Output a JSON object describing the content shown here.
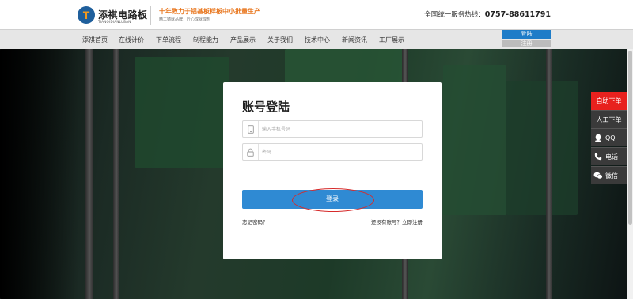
{
  "brand": {
    "name": "添祺电路板",
    "pinyin": "TIANQIDIANLUBAN",
    "slogan": "十年致力于铝基板样板中小批量生产",
    "slogan_sub": "精工铸就品牌，匠心成就理想"
  },
  "hotline": {
    "label": "全国统一服务热线：",
    "number": "0757-88611791"
  },
  "nav": {
    "items": [
      "添祺首页",
      "在线计价",
      "下单流程",
      "制程能力",
      "产品展示",
      "关于我们",
      "技术中心",
      "新闻资讯",
      "工厂展示"
    ],
    "login": "登陆",
    "register": "注册"
  },
  "login_form": {
    "title": "账号登陆",
    "phone_placeholder": "输入手机号码",
    "password_placeholder": "密码",
    "submit": "登录",
    "forgot": "忘记密码？",
    "register_prompt": "还没有账号？立即注册"
  },
  "sidebar": {
    "auto_order": "自助下单",
    "manual_order": "人工下单",
    "qq": "QQ",
    "phone": "电话",
    "wechat": "微信"
  },
  "colors": {
    "primary": "#2f8ad3",
    "accent": "#e8741a",
    "side_red": "#e8211e",
    "annotation": "#d62b2b"
  }
}
